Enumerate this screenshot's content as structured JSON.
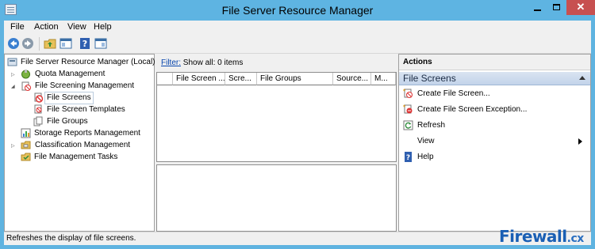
{
  "window": {
    "title": "File Server Resource Manager",
    "close_glyph": "✕"
  },
  "menubar": {
    "items": [
      "File",
      "Action",
      "View",
      "Help"
    ]
  },
  "toolbar": {
    "buttons": [
      "back-icon",
      "forward-icon",
      "up-folder-icon",
      "show-hide-tree-icon",
      "help-icon",
      "show-hide-action-pane-icon"
    ]
  },
  "tree": {
    "root": "File Server Resource Manager (Local)",
    "items": [
      {
        "label": "Quota Management",
        "icon": "quota-icon",
        "expander": "collapsed"
      },
      {
        "label": "File Screening Management",
        "icon": "file-screening-icon",
        "expander": "expanded"
      },
      {
        "label": "File Screens",
        "icon": "file-screen-icon",
        "selected": true
      },
      {
        "label": "File Screen Templates",
        "icon": "file-screen-template-icon"
      },
      {
        "label": "File Groups",
        "icon": "file-group-icon"
      },
      {
        "label": "Storage Reports Management",
        "icon": "storage-reports-icon"
      },
      {
        "label": "Classification Management",
        "icon": "classification-icon",
        "expander": "collapsed"
      },
      {
        "label": "File Management Tasks",
        "icon": "file-management-tasks-icon"
      }
    ]
  },
  "center": {
    "filter_link": "Filter:",
    "filter_text": "Show all: 0 items",
    "columns": [
      "File Screen ...",
      "Scre...",
      "File Groups",
      "Source...",
      "M..."
    ]
  },
  "actions": {
    "header": "Actions",
    "section": "File Screens",
    "items": [
      {
        "label": "Create File Screen...",
        "icon": "create-file-screen-icon"
      },
      {
        "label": "Create File Screen Exception...",
        "icon": "create-exception-icon"
      },
      {
        "label": "Refresh",
        "icon": "refresh-icon"
      },
      {
        "label": "View",
        "icon": "",
        "submenu": true
      },
      {
        "label": "Help",
        "icon": "help-icon"
      }
    ]
  },
  "statusbar": {
    "text": "Refreshes the display of file screens."
  },
  "watermark": {
    "main": "Firewall",
    "suffix": ".cx"
  },
  "colors": {
    "titlebar": "#5eb4e2",
    "close": "#c75050",
    "link": "#0645ad",
    "selected_section": "#c3d4ea"
  }
}
